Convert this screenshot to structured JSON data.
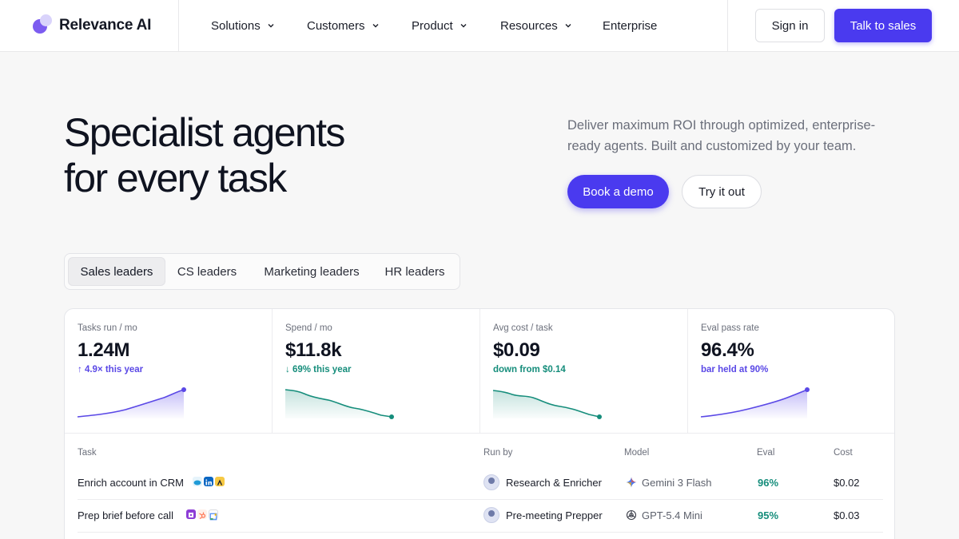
{
  "header": {
    "brand": "Relevance AI",
    "nav": [
      {
        "label": "Solutions",
        "has_menu": true
      },
      {
        "label": "Customers",
        "has_menu": true
      },
      {
        "label": "Product",
        "has_menu": true
      },
      {
        "label": "Resources",
        "has_menu": true
      },
      {
        "label": "Enterprise",
        "has_menu": false
      }
    ],
    "sign_in": "Sign in",
    "talk_to_sales": "Talk to sales"
  },
  "hero": {
    "title_line1": "Specialist agents",
    "title_line2": "for every task",
    "subtitle": "Deliver maximum ROI through optimized, enterprise-ready agents. Built and customized by your team.",
    "primary_cta": "Book a demo",
    "secondary_cta": "Try it out"
  },
  "tabs": {
    "active": "Sales leaders",
    "items": [
      "Sales leaders",
      "CS leaders",
      "Marketing leaders",
      "HR leaders"
    ]
  },
  "metrics": [
    {
      "label": "Tasks run / mo",
      "value": "1.24M",
      "delta": "↑ 4.9× this year",
      "trend": "up",
      "color": "#5a48e6"
    },
    {
      "label": "Spend / mo",
      "value": "$11.8k",
      "delta": "↓ 69% this year",
      "trend": "down",
      "color": "#158d7b"
    },
    {
      "label": "Avg cost / task",
      "value": "$0.09",
      "delta": "down from $0.14",
      "trend": "down",
      "color": "#158d7b"
    },
    {
      "label": "Eval pass rate",
      "value": "96.4%",
      "delta": "bar held at 90%",
      "trend": "up",
      "color": "#5a48e6"
    }
  ],
  "table": {
    "columns": [
      "Task",
      "Run by",
      "Model",
      "Eval",
      "Cost"
    ],
    "rows": [
      {
        "task": "Enrich account in CRM",
        "run_by": "Research & Enricher",
        "model": "Gemini 3 Flash",
        "eval": "96%",
        "cost": "$0.02",
        "tools": [
          "salesforce-icon",
          "linkedin-icon",
          "apollo-icon"
        ],
        "model_icon": "gemini-icon"
      },
      {
        "task": "Prep brief before call",
        "run_by": "Pre-meeting Prepper",
        "model": "GPT-5.4 Mini",
        "eval": "95%",
        "cost": "$0.03",
        "tools": [
          "gong-icon",
          "hubspot-icon",
          "calendar-icon"
        ],
        "model_icon": "openai-icon"
      }
    ]
  },
  "colors": {
    "accent": "#4a3aef",
    "positive": "#158d7b",
    "purple_trend": "#5a48e6"
  }
}
